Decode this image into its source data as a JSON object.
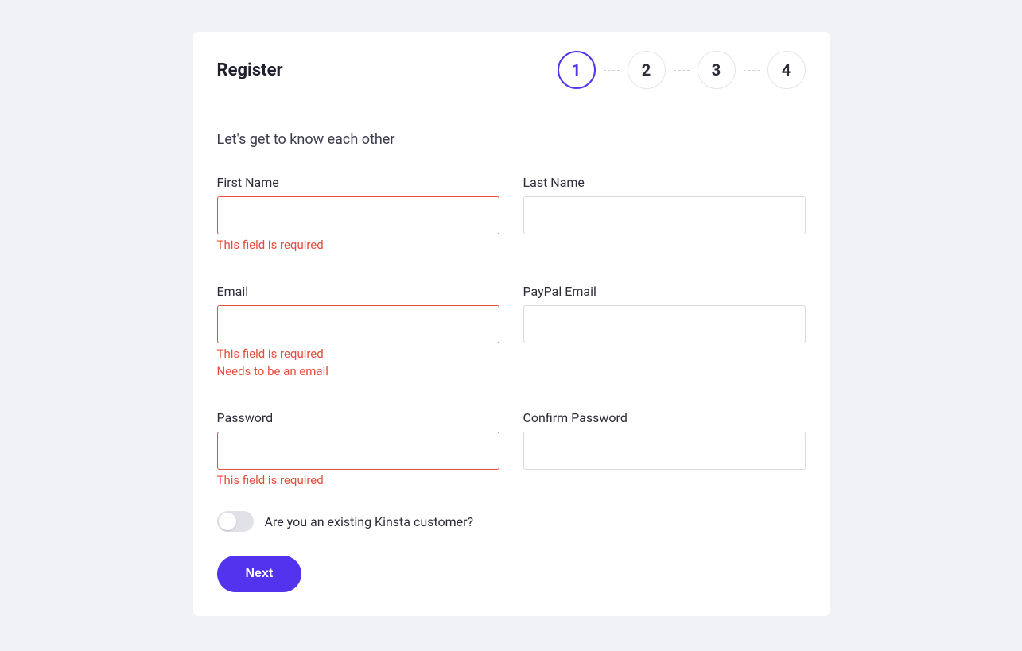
{
  "header": {
    "title": "Register",
    "steps": [
      "1",
      "2",
      "3",
      "4"
    ],
    "activeStep": 0
  },
  "subtitle": "Let's get to know each other",
  "fields": {
    "firstName": {
      "label": "First Name",
      "value": "",
      "errors": [
        "This field is required"
      ]
    },
    "lastName": {
      "label": "Last Name",
      "value": "",
      "errors": []
    },
    "email": {
      "label": "Email",
      "value": "",
      "errors": [
        "This field is required",
        "Needs to be an email"
      ]
    },
    "paypalEmail": {
      "label": "PayPal Email",
      "value": "",
      "errors": []
    },
    "password": {
      "label": "Password",
      "value": "",
      "errors": [
        "This field is required"
      ]
    },
    "confirmPassword": {
      "label": "Confirm Password",
      "value": "",
      "errors": []
    }
  },
  "toggle": {
    "label": "Are you an existing Kinsta customer?",
    "value": false
  },
  "buttons": {
    "next": "Next"
  }
}
